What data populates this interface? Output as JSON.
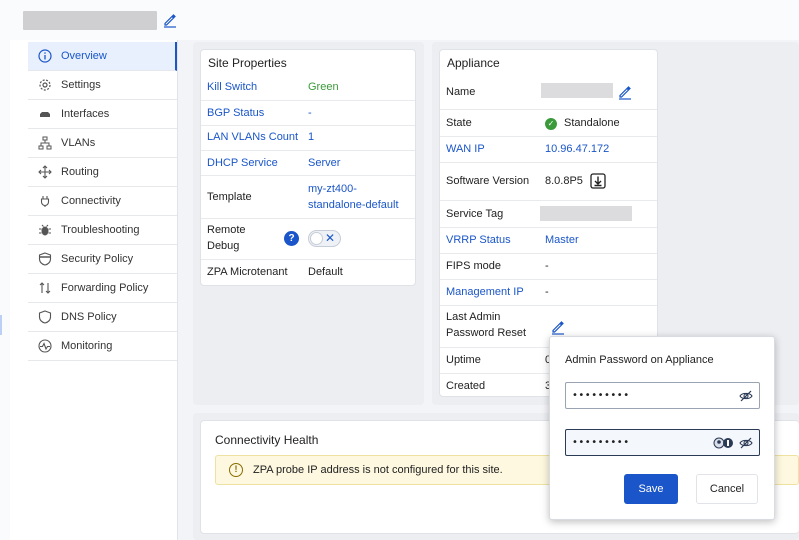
{
  "sidebar": {
    "items": [
      {
        "label": "Overview",
        "icon": "info-icon"
      },
      {
        "label": "Settings",
        "icon": "gear-icon"
      },
      {
        "label": "Interfaces",
        "icon": "interfaces-icon"
      },
      {
        "label": "VLANs",
        "icon": "vlan-icon"
      },
      {
        "label": "Routing",
        "icon": "routing-icon"
      },
      {
        "label": "Connectivity",
        "icon": "plug-icon"
      },
      {
        "label": "Troubleshooting",
        "icon": "bug-icon"
      },
      {
        "label": "Security Policy",
        "icon": "shield-icon"
      },
      {
        "label": "Forwarding Policy",
        "icon": "forwarding-icon"
      },
      {
        "label": "DNS Policy",
        "icon": "dns-shield-icon"
      },
      {
        "label": "Monitoring",
        "icon": "monitoring-icon"
      }
    ]
  },
  "site_properties": {
    "title": "Site Properties",
    "kill_switch": {
      "label": "Kill Switch",
      "value": "Green"
    },
    "bgp_status": {
      "label": "BGP Status",
      "value": "-"
    },
    "lan_vlans": {
      "label": "LAN VLANs Count",
      "value": "1"
    },
    "dhcp": {
      "label": "DHCP Service",
      "value": "Server"
    },
    "template": {
      "label": "Template",
      "value_line1": "my-zt400-",
      "value_line2": "standalone-default"
    },
    "remote_debug": {
      "label_line1": "Remote",
      "label_line2": "Debug",
      "help": "?",
      "toggle_off_symbol": "✕"
    },
    "zpa": {
      "label": "ZPA Microtenant",
      "value": "Default"
    }
  },
  "appliance": {
    "title": "Appliance",
    "name": {
      "label": "Name"
    },
    "state": {
      "label": "State",
      "value": "Standalone"
    },
    "wan_ip": {
      "label": "WAN IP",
      "value": "10.96.47.172"
    },
    "software": {
      "label": "Software Version",
      "value": "8.0.8P5"
    },
    "service_tag": {
      "label": "Service Tag"
    },
    "vrrp": {
      "label": "VRRP Status",
      "value": "Master"
    },
    "fips": {
      "label": "FIPS mode",
      "value": "-"
    },
    "mgmt_ip": {
      "label": "Management IP",
      "value": "-"
    },
    "last_admin": {
      "label_line1": "Last Admin",
      "label_line2": "Password Reset"
    },
    "uptime": {
      "label": "Uptime",
      "value": "0"
    },
    "created": {
      "label": "Created",
      "value": "3"
    }
  },
  "connectivity": {
    "title": "Connectivity Health",
    "warning": "ZPA probe IP address is not configured for this site."
  },
  "popup": {
    "title": "Admin Password on Appliance",
    "password1": "•••••••••",
    "password2": "•••••••••",
    "save_label": "Save",
    "cancel_label": "Cancel"
  },
  "colors": {
    "accent": "#1a56c9",
    "success": "#3a9a3a",
    "warning_bg": "#fdf8df"
  }
}
